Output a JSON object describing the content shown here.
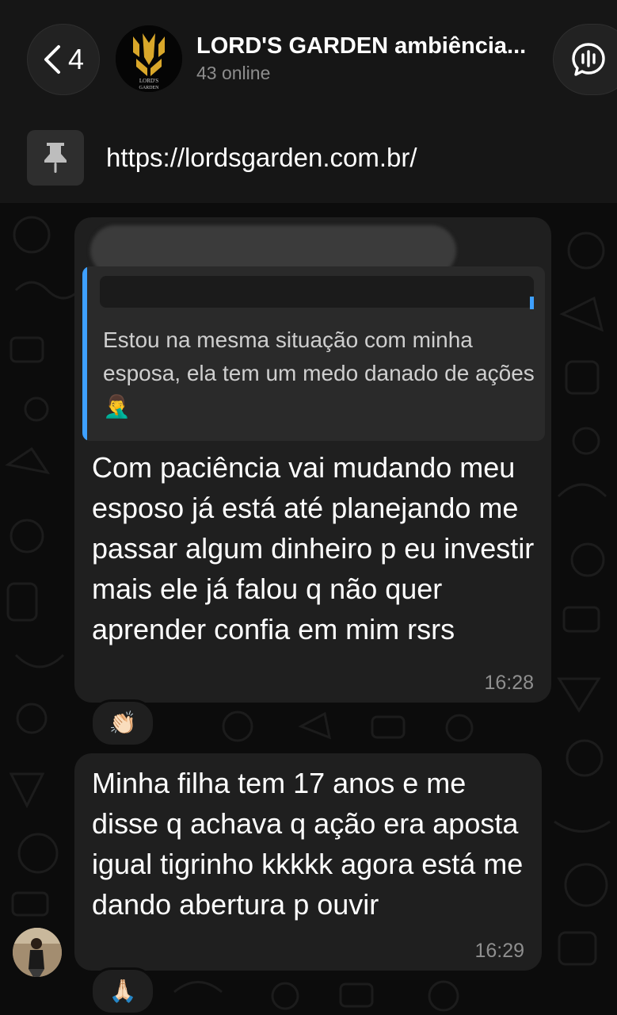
{
  "header": {
    "back_count": "4",
    "group_name": "LORD'S GARDEN ambiência...",
    "status": "43 online",
    "logo_text": [
      "LORD'S",
      "GARDEN"
    ]
  },
  "pinned": {
    "text": "https://lordsgarden.com.br/"
  },
  "messages": [
    {
      "quote_text": "Estou na mesma situação com minha esposa, ela tem um medo danado de ações 🤦‍♂️",
      "text": "Com paciência vai mudando meu esposo já está até planejando me passar algum dinheiro p eu investir mais ele já falou q não quer aprender confia em mim rsrs",
      "time": "16:28",
      "reaction": "👏🏻"
    },
    {
      "text": "Minha filha tem 17 anos e me disse q achava q ação era aposta igual tigrinho kkkkk agora está me dando abertura p ouvir",
      "time": "16:29",
      "reaction": "🙏🏻"
    }
  ],
  "colors": {
    "accent_quote": "#3ea0ff",
    "bubble": "#1f1f1f",
    "header_bg": "#161616"
  }
}
